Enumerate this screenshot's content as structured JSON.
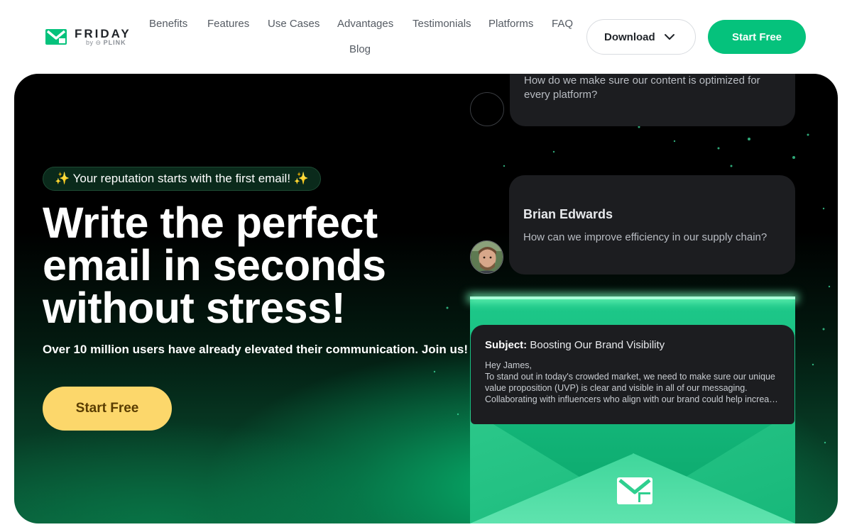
{
  "brand": {
    "name": "FRIDAY",
    "by": "by",
    "parent": "PLINK",
    "accent": "#05c27c",
    "cta_yellow": "#fcd76b"
  },
  "nav": {
    "links": [
      "Benefits",
      "Features",
      "Use Cases",
      "Advantages",
      "Testimonials",
      "Platforms",
      "FAQ",
      "Blog"
    ],
    "download_label": "Download",
    "start_label": "Start Free"
  },
  "hero": {
    "tag": "✨ Your reputation starts with the first email! ✨",
    "headline": [
      "Write the perfect",
      "email in seconds",
      "without stress!"
    ],
    "subline": "Over 10 million users have already elevated their communication. Join us!",
    "cta_label": "Start Free"
  },
  "chat": {
    "card1_text": "How do we make sure our content is optimized for every platform?",
    "card2_name": "Brian Edwards",
    "card2_text": "How can we improve efficiency in our supply chain?"
  },
  "email": {
    "subject_label": "Subject:",
    "subject": "Boosting Our Brand Visibility",
    "body": [
      "Hey James,",
      "To stand out in today's crowded market, we need to make sure our unique",
      "value proposition (UVP) is clear and visible in all of our messaging.",
      "Collaborating with influencers who align with our brand could help increase …"
    ]
  },
  "icons": {
    "logo": "friday-logo-icon",
    "download_chevron": "chevron-down-icon",
    "envelope": "envelope-icon"
  }
}
